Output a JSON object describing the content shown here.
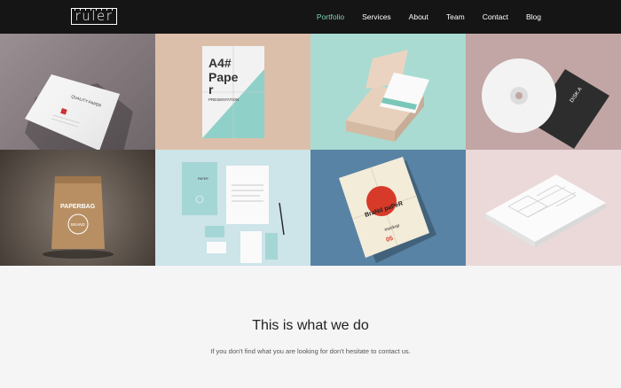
{
  "brand": {
    "logo_text": "ruler"
  },
  "nav": {
    "items": [
      {
        "label": "Portfolio",
        "active": true
      },
      {
        "label": "Services",
        "active": false
      },
      {
        "label": "About",
        "active": false
      },
      {
        "label": "Team",
        "active": false
      },
      {
        "label": "Contact",
        "active": false
      },
      {
        "label": "Blog",
        "active": false
      }
    ]
  },
  "portfolio": {
    "tiles": [
      {
        "subject": "letterhead-paper-mockup",
        "bg": "#8b7f84",
        "texts": [
          "QUALITY PAPER"
        ]
      },
      {
        "subject": "a4-paper-presentation-mockup",
        "bg": "#dcc0ad",
        "texts": [
          "A4#",
          "Pape",
          "r",
          "PRESENTATION"
        ]
      },
      {
        "subject": "business-card-box-mockup",
        "bg": "#a9dbd2",
        "texts": []
      },
      {
        "subject": "cd-disc-mockup",
        "bg": "#c2a7a7",
        "texts": [
          "DISK A"
        ]
      },
      {
        "subject": "paper-bag-mockup",
        "bg": "#6f655d",
        "texts": [
          "PAPERBAG",
          "BRAND"
        ]
      },
      {
        "subject": "stationery-branding-mockup",
        "bg": "#cfe5ea",
        "texts": [
          "PAPER"
        ]
      },
      {
        "subject": "folded-poster-mockup",
        "bg": "#5b83a4",
        "texts": [
          "BraNd paPeR",
          "mockup",
          "05"
        ]
      },
      {
        "subject": "embossed-paper-mockup",
        "bg": "#ead6d6",
        "texts": []
      }
    ]
  },
  "section": {
    "title": "This is what we do",
    "subtitle": "If you don't find what you are looking for don't hesitate to contact us."
  }
}
